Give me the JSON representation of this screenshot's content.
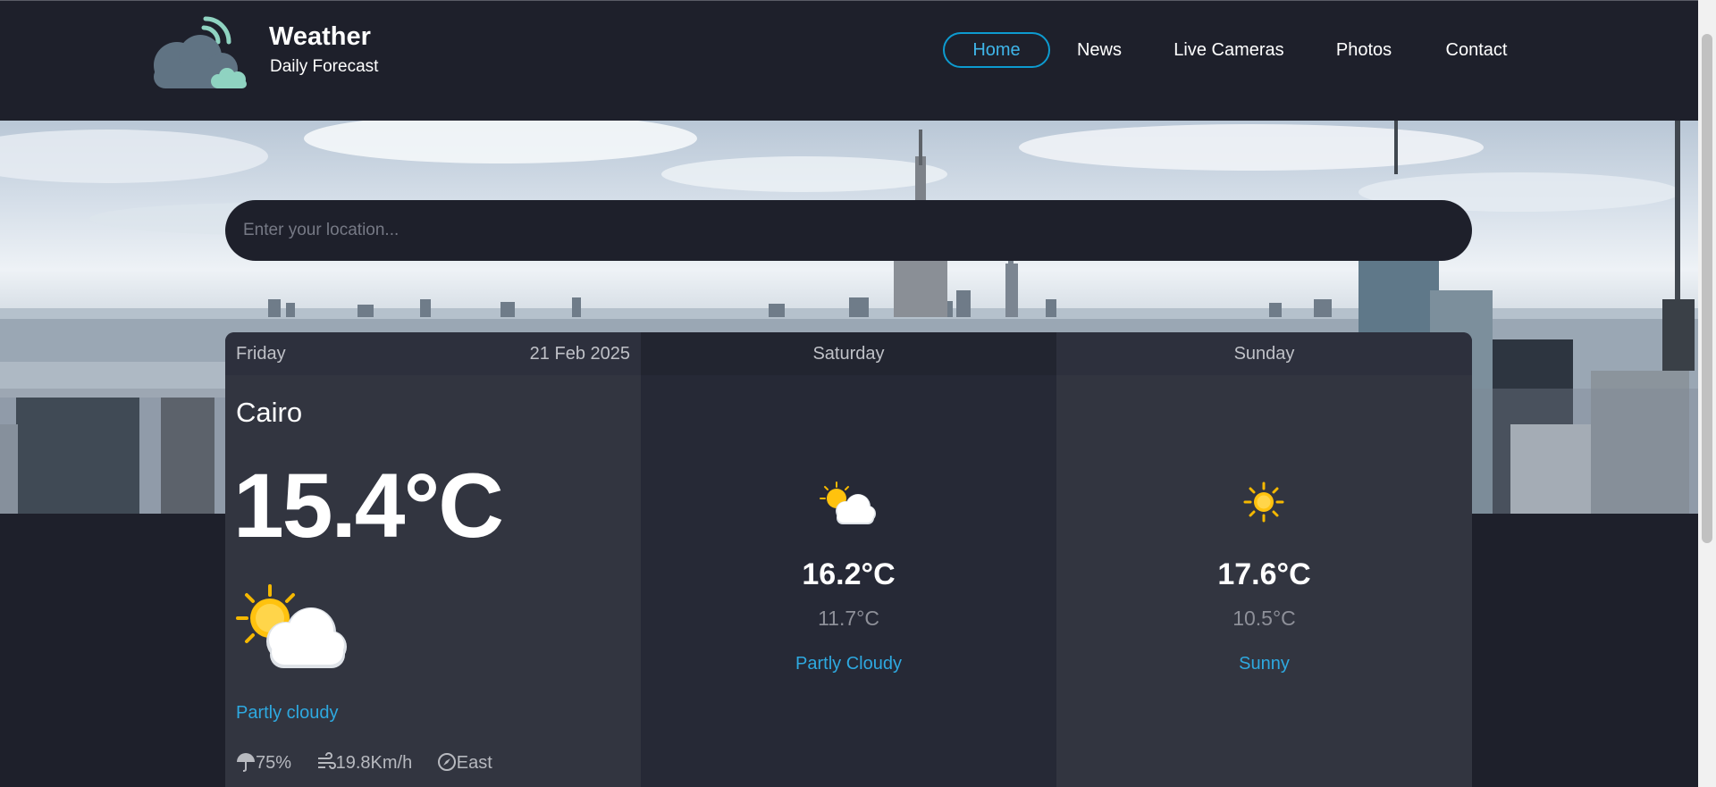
{
  "brand": {
    "title": "Weather",
    "subtitle": "Daily Forecast",
    "icon": "cloud-signal-icon"
  },
  "nav": {
    "items": [
      {
        "label": "Home",
        "active": true
      },
      {
        "label": "News",
        "active": false
      },
      {
        "label": "Live Cameras",
        "active": false
      },
      {
        "label": "Photos",
        "active": false
      },
      {
        "label": "Contact",
        "active": false
      }
    ]
  },
  "search": {
    "placeholder": "Enter your location...",
    "value": ""
  },
  "today": {
    "day": "Friday",
    "date": "21 Feb 2025",
    "city": "Cairo",
    "temp": "15.4°C",
    "icon": "partly-cloudy-icon",
    "condition": "Partly cloudy",
    "humidity": "75%",
    "wind_speed": "19.8Km/h",
    "wind_direction": "East"
  },
  "forecast": [
    {
      "day": "Saturday",
      "icon": "partly-cloudy-icon",
      "max": "16.2°C",
      "min": "11.7°C",
      "condition": "Partly Cloudy"
    },
    {
      "day": "Sunday",
      "icon": "sunny-icon",
      "max": "17.6°C",
      "min": "10.5°C",
      "condition": "Sunny"
    }
  ],
  "colors": {
    "background": "#1e202b",
    "accent": "#2ea9e0",
    "card": "#323540",
    "card_alt": "#262936"
  }
}
